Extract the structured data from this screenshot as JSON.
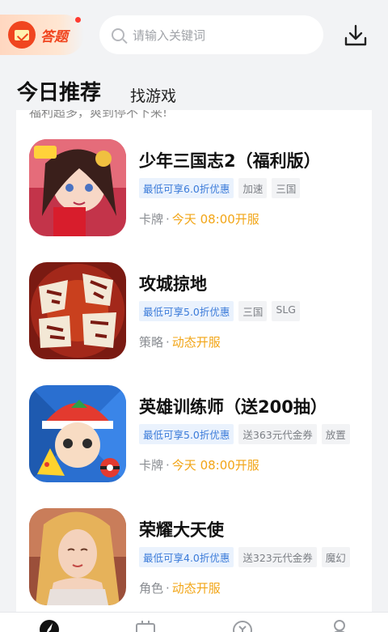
{
  "header": {
    "quiz_label": "答题",
    "search_placeholder": "请输入关键词"
  },
  "tabs": [
    {
      "label": "今日推荐",
      "active": true
    },
    {
      "label": "找游戏",
      "active": false
    }
  ],
  "top_text": "福利超多，爽到停不下来!",
  "games": [
    {
      "name": "少年三国志2（福利版）",
      "discount": "最低可享6.0折优惠",
      "tags": [
        "加速",
        "三国"
      ],
      "category": "卡牌",
      "time": "今天 08:00开服"
    },
    {
      "name": "攻城掠地",
      "discount": "最低可享5.0折优惠",
      "tags": [
        "三国",
        "SLG"
      ],
      "category": "策略",
      "time": "动态开服"
    },
    {
      "name": "英雄训练师（送200抽）",
      "discount": "最低可享5.0折优惠",
      "tags": [
        "送363元代金券",
        "放置"
      ],
      "category": "卡牌",
      "time": "今天 08:00开服"
    },
    {
      "name": "荣耀大天使",
      "discount": "最低可享4.0折优惠",
      "tags": [
        "送323元代金券",
        "魔幻"
      ],
      "category": "角色",
      "time": "动态开服"
    }
  ],
  "colors": {
    "accent_orange": "#f2a516",
    "discount_blue": "#3b7bd9",
    "quiz_red": "#f0451f"
  }
}
